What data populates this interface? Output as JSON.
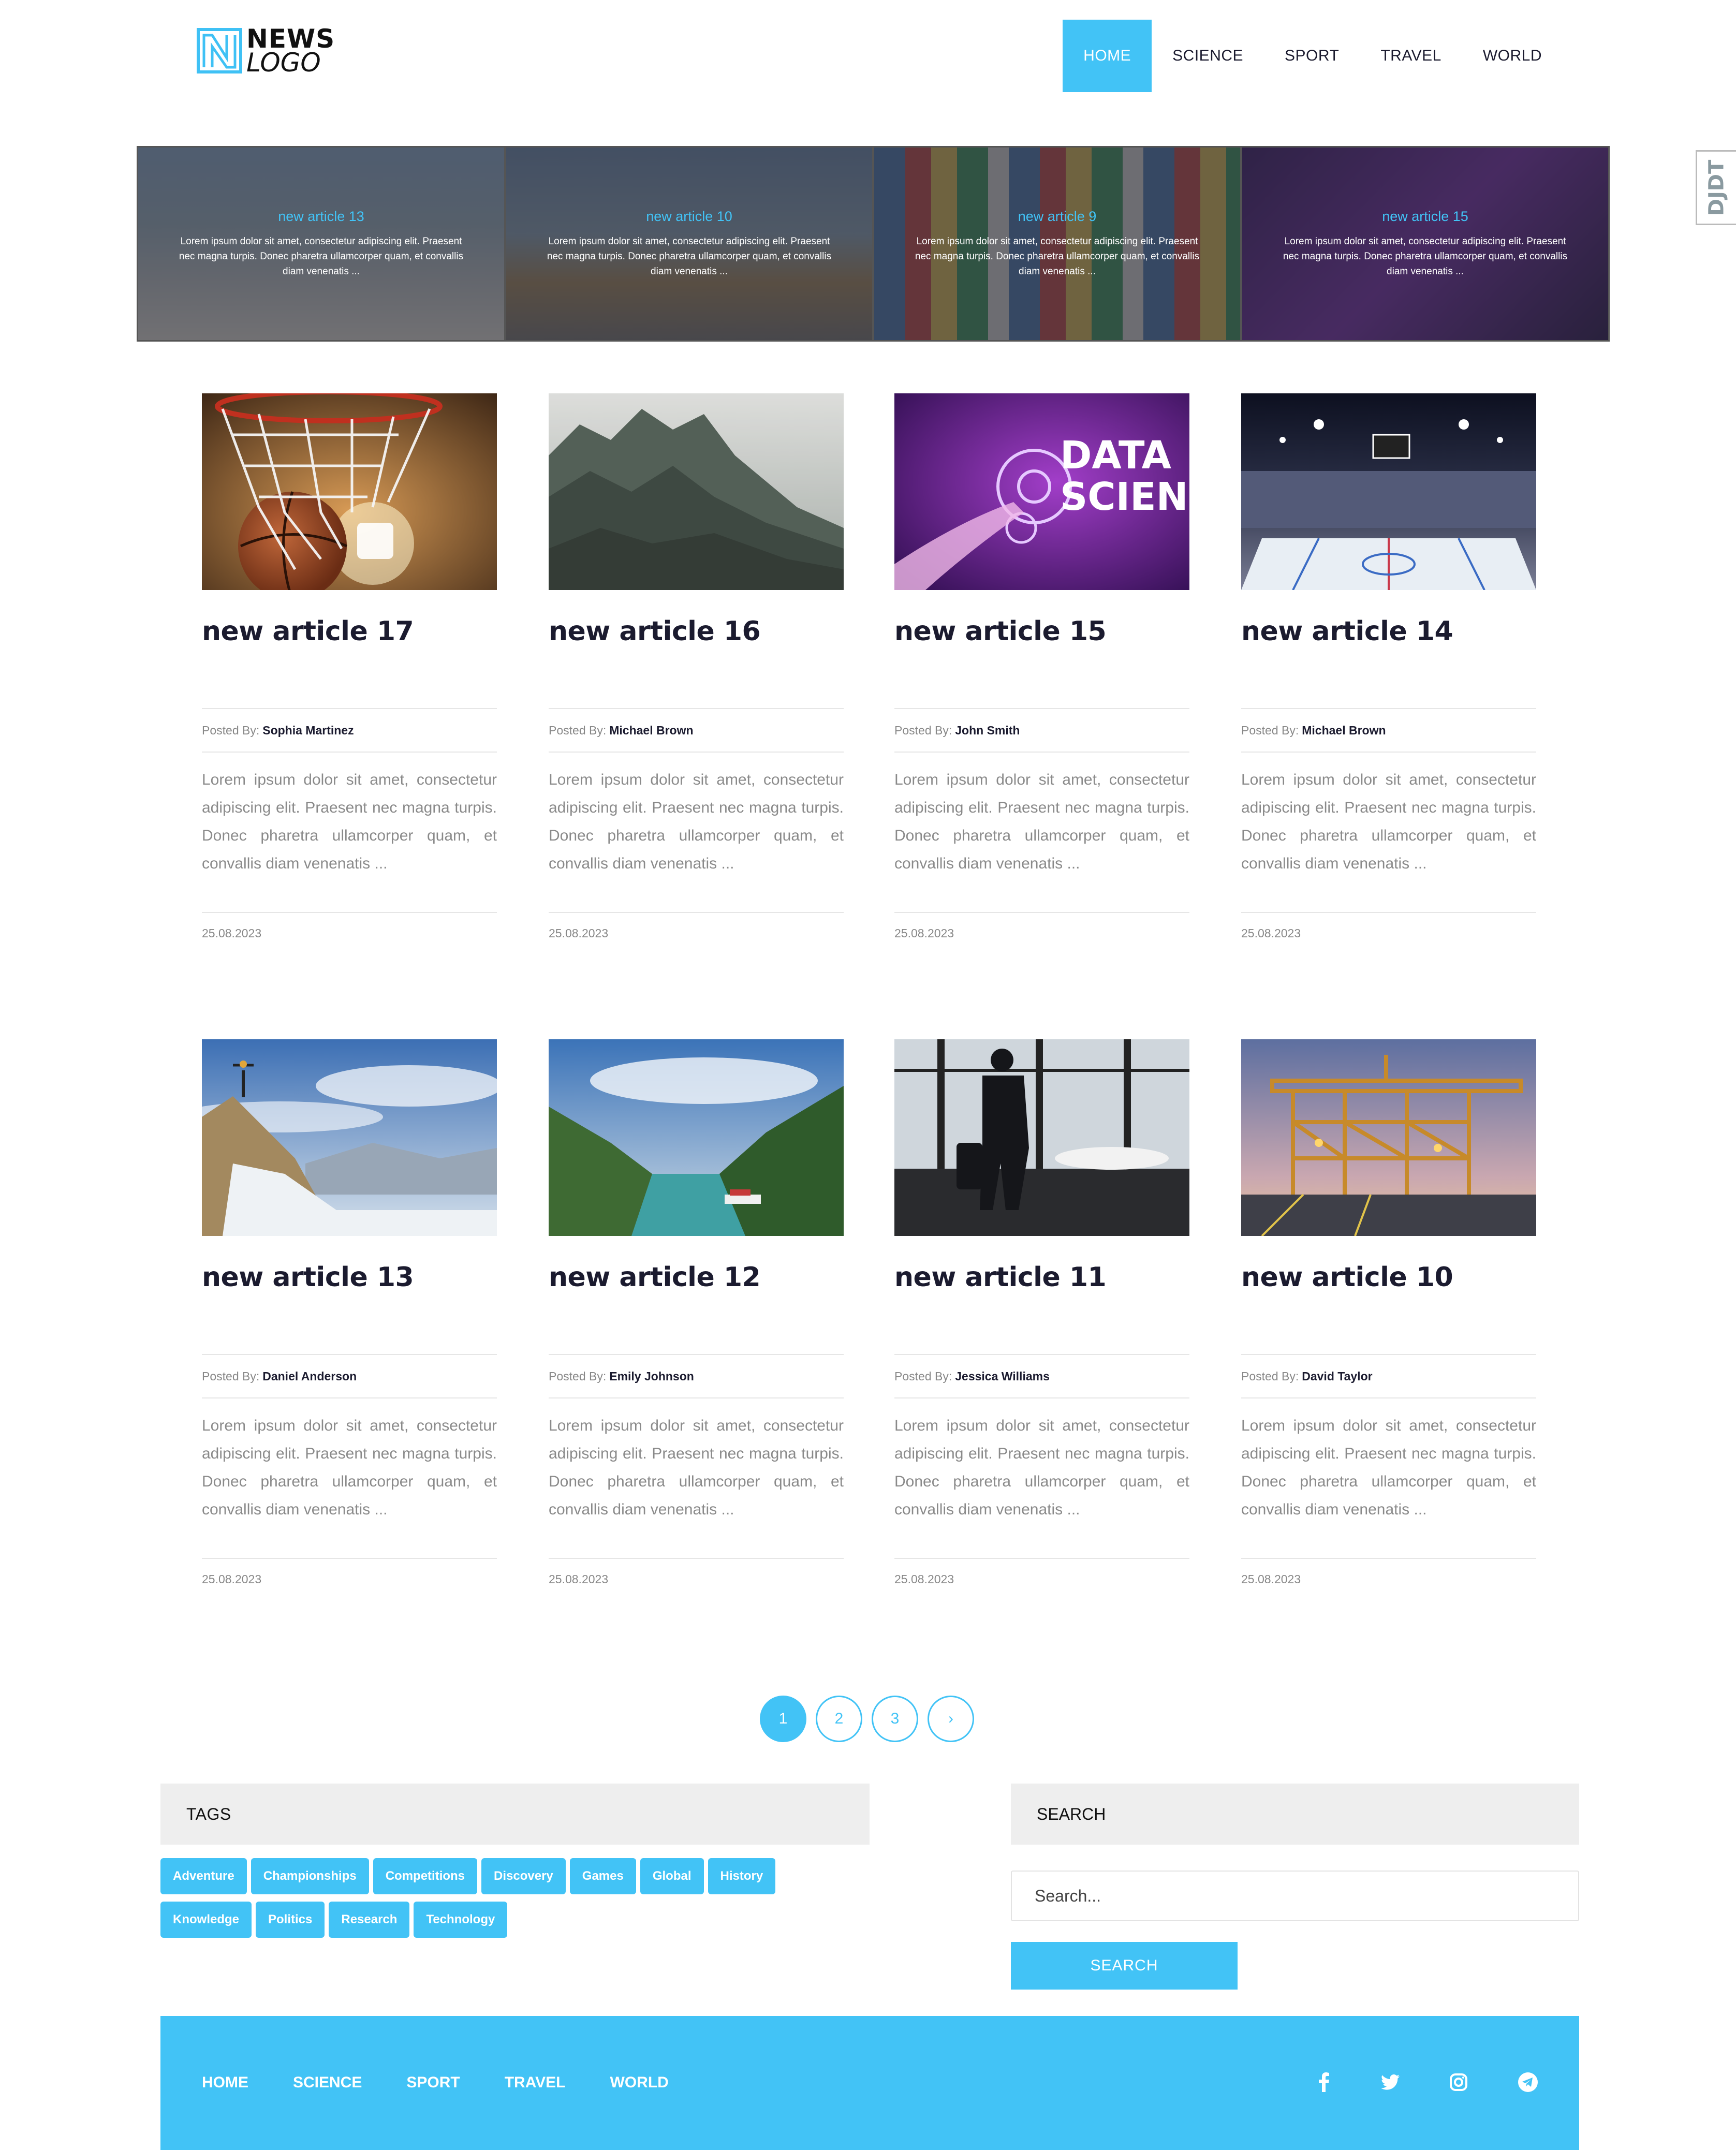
{
  "brand": {
    "line1": "NEWS",
    "line2": "LOGO"
  },
  "nav": [
    {
      "label": "HOME",
      "active": true
    },
    {
      "label": "SCIENCE",
      "active": false
    },
    {
      "label": "SPORT",
      "active": false
    },
    {
      "label": "TRAVEL",
      "active": false
    },
    {
      "label": "WORLD",
      "active": false
    }
  ],
  "side_badge": {
    "label": "DJDT"
  },
  "slider": [
    {
      "title": "new article 13",
      "text": "Lorem ipsum dolor sit amet, consectetur adipiscing elit. Praesent nec magna turpis. Donec pharetra ullamcorper quam, et convallis diam venenatis ..."
    },
    {
      "title": "new article 10",
      "text": "Lorem ipsum dolor sit amet, consectetur adipiscing elit. Praesent nec magna turpis. Donec pharetra ullamcorper quam, et convallis diam venenatis ..."
    },
    {
      "title": "new article 9",
      "text": "Lorem ipsum dolor sit amet, consectetur adipiscing elit. Praesent nec magna turpis. Donec pharetra ullamcorper quam, et convallis diam venenatis ..."
    },
    {
      "title": "new article 15",
      "text": "Lorem ipsum dolor sit amet, consectetur adipiscing elit. Praesent nec magna turpis. Donec pharetra ullamcorper quam, et convallis diam venenatis ..."
    }
  ],
  "posted_by_label": "Posted By:",
  "articles": [
    {
      "title": "new article 17",
      "author": "Sophia Martinez",
      "excerpt": "Lorem ipsum dolor sit amet, consectetur adipiscing elit. Praesent nec magna turpis. Donec pharetra ullamcorper quam, et convallis diam venenatis ...",
      "date": "25.08.2023",
      "image": "basketball"
    },
    {
      "title": "new article 16",
      "author": "Michael Brown",
      "excerpt": "Lorem ipsum dolor sit amet, consectetur adipiscing elit. Praesent nec magna turpis. Donec pharetra ullamcorper quam, et convallis diam venenatis ...",
      "date": "25.08.2023",
      "image": "misty-forest"
    },
    {
      "title": "new article 15",
      "author": "John Smith",
      "excerpt": "Lorem ipsum dolor sit amet, consectetur adipiscing elit. Praesent nec magna turpis. Donec pharetra ullamcorper quam, et convallis diam venenatis ...",
      "date": "25.08.2023",
      "image": "data-science",
      "image_text": [
        "DATA",
        "SCIENCE"
      ]
    },
    {
      "title": "new article 14",
      "author": "Michael Brown",
      "excerpt": "Lorem ipsum dolor sit amet, consectetur adipiscing elit. Praesent nec magna turpis. Donec pharetra ullamcorper quam, et convallis diam venenatis ...",
      "date": "25.08.2023",
      "image": "hockey-arena"
    },
    {
      "title": "new article 13",
      "author": "Daniel Anderson",
      "excerpt": "Lorem ipsum dolor sit amet, consectetur adipiscing elit. Praesent nec magna turpis. Donec pharetra ullamcorper quam, et convallis diam venenatis ...",
      "date": "25.08.2023",
      "image": "mountain-summit"
    },
    {
      "title": "new article 12",
      "author": "Emily Johnson",
      "excerpt": "Lorem ipsum dolor sit amet, consectetur adipiscing elit. Praesent nec magna turpis. Donec pharetra ullamcorper quam, et convallis diam venenatis ...",
      "date": "25.08.2023",
      "image": "fjord"
    },
    {
      "title": "new article 11",
      "author": "Jessica Williams",
      "excerpt": "Lorem ipsum dolor sit amet, consectetur adipiscing elit. Praesent nec magna turpis. Donec pharetra ullamcorper quam, et convallis diam venenatis ...",
      "date": "25.08.2023",
      "image": "airport-traveler"
    },
    {
      "title": "new article 10",
      "author": "David Taylor",
      "excerpt": "Lorem ipsum dolor sit amet, consectetur adipiscing elit. Praesent nec magna turpis. Donec pharetra ullamcorper quam, et convallis diam venenatis ...",
      "date": "25.08.2023",
      "image": "port-cranes"
    }
  ],
  "pagination": {
    "pages": [
      "1",
      "2",
      "3"
    ],
    "current": "1",
    "next": "›"
  },
  "tags": {
    "title": "TAGS",
    "items": [
      "Adventure",
      "Championships",
      "Competitions",
      "Discovery",
      "Games",
      "Global",
      "History",
      "Knowledge",
      "Politics",
      "Research",
      "Technology"
    ]
  },
  "search": {
    "title": "SEARCH",
    "placeholder": "Search...",
    "button": "SEARCH"
  },
  "footer": {
    "links": [
      "HOME",
      "SCIENCE",
      "SPORT",
      "TRAVEL",
      "WORLD"
    ],
    "social": [
      "facebook-icon",
      "twitter-icon",
      "instagram-icon",
      "telegram-icon"
    ]
  },
  "colors": {
    "accent": "#42c3f6",
    "text": "#1b1b2f",
    "muted": "#888888",
    "panel": "#eeeeee"
  }
}
